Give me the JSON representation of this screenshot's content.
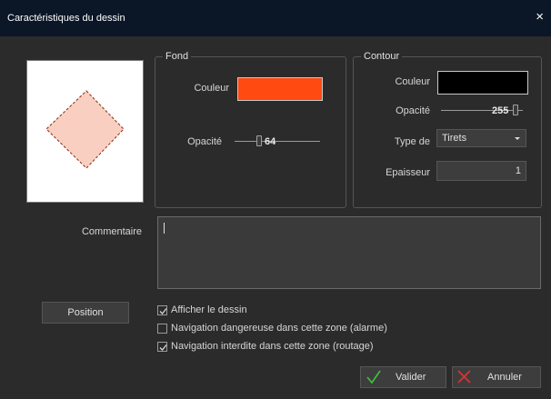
{
  "window": {
    "title": "Caractéristiques du dessin",
    "close_glyph": "×"
  },
  "preview": {
    "fill_color": "#f8cfc0",
    "stroke_color": "#8a2a10",
    "stroke_style": "dashed"
  },
  "fond": {
    "legend": "Fond",
    "couleur_label": "Couleur",
    "couleur_value": "#ff4a12",
    "opacite_label": "Opacité",
    "opacite_value": "64"
  },
  "contour": {
    "legend": "Contour",
    "couleur_label": "Couleur",
    "couleur_value": "#000000",
    "opacite_label": "Opacité",
    "opacite_value": "255",
    "type_label": "Type de",
    "type_value": "Tirets",
    "epaisseur_label": "Epaisseur",
    "epaisseur_value": "1"
  },
  "commentaire": {
    "label": "Commentaire",
    "value": ""
  },
  "position_button": "Position",
  "checkboxes": [
    {
      "label": "Afficher le dessin",
      "checked": true
    },
    {
      "label": "Navigation dangereuse dans cette zone (alarme)",
      "checked": false
    },
    {
      "label": "Navigation interdite dans cette zone (routage)",
      "checked": true
    }
  ],
  "buttons": {
    "valider": "Valider",
    "annuler": "Annuler",
    "valider_icon_color": "#3cc43c",
    "annuler_icon_color": "#e03030"
  }
}
